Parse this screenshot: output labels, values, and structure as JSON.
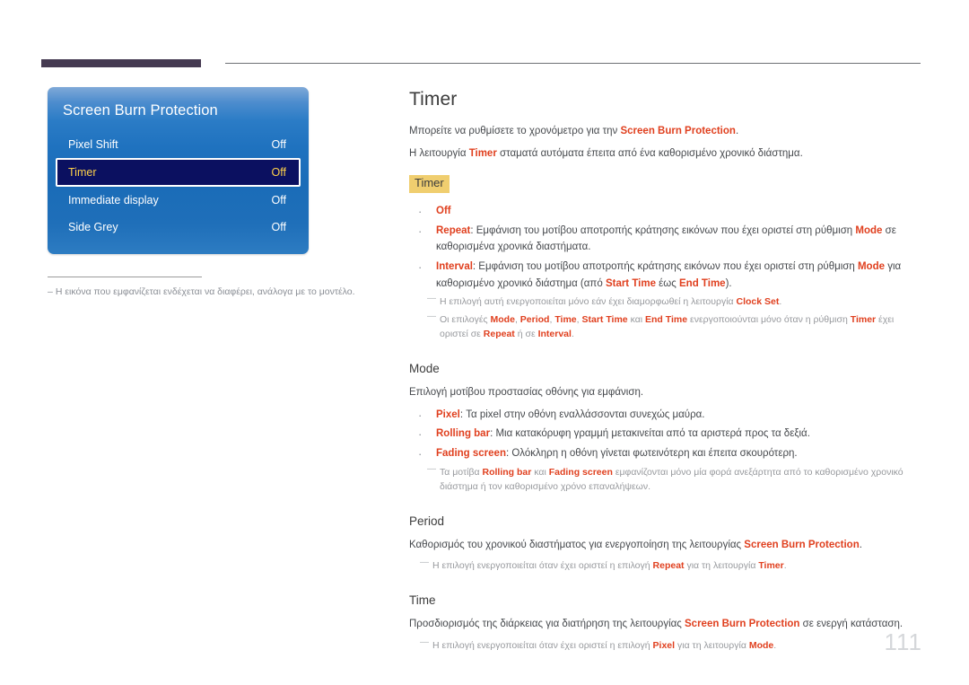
{
  "colors": {
    "accent": "#e0401f",
    "highlight_box_bg": "#f0ce6f",
    "osd_selected_bg": "#0b1060",
    "osd_selected_text": "#ffd24a",
    "top_bar_dark": "#453a51",
    "page_number": "#d5d7da"
  },
  "osd": {
    "title": "Screen Burn Protection",
    "rows": [
      {
        "label": "Pixel Shift",
        "value": "Off",
        "selected": false
      },
      {
        "label": "Timer",
        "value": "Off",
        "selected": true
      },
      {
        "label": "Immediate display",
        "value": "Off",
        "selected": false
      },
      {
        "label": "Side Grey",
        "value": "Off",
        "selected": false
      }
    ]
  },
  "left_note": {
    "dash": "–",
    "text": "Η εικόνα που εμφανίζεται ενδέχεται να διαφέρει, ανάλογα με το μοντέλο."
  },
  "content": {
    "title": "Timer",
    "intro": {
      "line1_a": "Μπορείτε να ρυθμίσετε το χρονόμετρο για την ",
      "line1_accent": "Screen Burn Protection",
      "line1_b": ".",
      "line2_a": "Η λειτουργία ",
      "line2_accent": "Timer",
      "line2_b": " σταματά αυτόματα έπειτα από ένα καθορισμένο χρονικό διάστημα."
    },
    "timer_box": "Timer",
    "timer_bullets": [
      {
        "accent": "Off",
        "rest": ""
      },
      {
        "accent": "Repeat",
        "rest_a": ": Εμφάνιση του μοτίβου αποτροπής κράτησης εικόνων που έχει οριστεί στη ρύθμιση ",
        "inline_accent": "Mode",
        "rest_b": " σε καθορισμένα χρονικά διαστήματα."
      },
      {
        "accent": "Interval",
        "rest_a": ": Εμφάνιση του μοτίβου αποτροπής κράτησης εικόνων που έχει οριστεί στη ρύθμιση ",
        "inline_accent": "Mode",
        "rest_b": " για καθορισμένο χρονικό διάστημα (από ",
        "inline_accent2": "Start Time",
        "rest_c": " έως ",
        "inline_accent3": "End Time",
        "rest_d": ")."
      }
    ],
    "timer_subnotes": [
      {
        "a": "Η επιλογή αυτή ενεργοποιείται μόνο εάν έχει διαμορφωθεί η λειτουργία ",
        "accent": "Clock Set",
        "b": "."
      },
      {
        "a": "Οι επιλογές ",
        "accent1": "Mode",
        "sep1": ", ",
        "accent2": "Period",
        "sep2": ", ",
        "accent3": "Time",
        "sep3": ", ",
        "accent4": "Start Time",
        "sep4": " και ",
        "accent5": "End Time",
        "b": " ενεργοποιούνται μόνο όταν η ρύθμιση ",
        "accent6": "Timer",
        "c": " έχει οριστεί σε ",
        "accent7": "Repeat",
        "d": " ή σε ",
        "accent8": "Interval",
        "e": "."
      }
    ],
    "mode": {
      "title": "Mode",
      "intro": "Επιλογή μοτίβου προστασίας οθόνης για εμφάνιση.",
      "bullets": [
        {
          "accent": "Pixel",
          "rest": ": Τα pixel στην οθόνη εναλλάσσονται συνεχώς μαύρα."
        },
        {
          "accent": "Rolling bar",
          "rest": ": Μια κατακόρυφη γραμμή μετακινείται από τα αριστερά προς τα δεξιά."
        },
        {
          "accent": "Fading screen",
          "rest": ": Ολόκληρη η οθόνη γίνεται φωτεινότερη και έπειτα σκουρότερη."
        }
      ],
      "subnote": {
        "a": "Τα μοτίβα ",
        "accent1": "Rolling bar",
        "mid": " και ",
        "accent2": "Fading screen",
        "b": " εμφανίζονται μόνο μία φορά ανεξάρτητα από το καθορισμένο χρονικό διάστημα ή τον καθορισμένο χρόνο επαναλήψεων."
      }
    },
    "period": {
      "title": "Period",
      "intro_a": "Καθορισμός του χρονικού διαστήματος για ενεργοποίηση της λειτουργίας ",
      "intro_accent": "Screen Burn Protection",
      "intro_b": ".",
      "subnote": {
        "a": "Η επιλογή ενεργοποιείται όταν έχει οριστεί η επιλογή ",
        "accent1": "Repeat",
        "b": " για τη λειτουργία ",
        "accent2": "Timer",
        "c": "."
      }
    },
    "time": {
      "title": "Time",
      "intro_a": "Προσδιορισμός της διάρκειας για διατήρηση της λειτουργίας ",
      "intro_accent": "Screen Burn Protection",
      "intro_b": " σε ενεργή κατάσταση.",
      "subnote": {
        "a": "Η επιλογή ενεργοποιείται όταν έχει οριστεί η επιλογή ",
        "accent1": "Pixel",
        "b": " για τη λειτουργία ",
        "accent2": "Mode",
        "c": "."
      }
    }
  },
  "page_number": "111"
}
